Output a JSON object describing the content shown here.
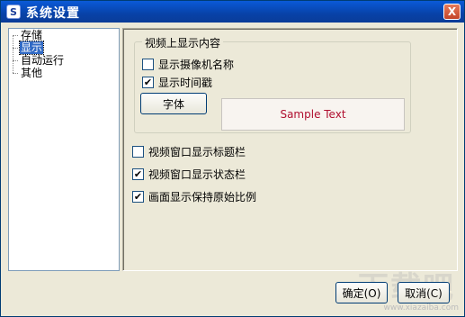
{
  "window": {
    "title": "系统设置",
    "close_label": "X"
  },
  "tree": {
    "items": [
      {
        "label": "存储",
        "selected": false
      },
      {
        "label": "显示",
        "selected": true
      },
      {
        "label": "自动运行",
        "selected": false
      },
      {
        "label": "其他",
        "selected": false
      }
    ]
  },
  "display": {
    "group_title": "视频上显示内容",
    "show_camera_name": {
      "label": "显示摄像机名称",
      "checked": false
    },
    "show_timestamp": {
      "label": "显示时间戳",
      "checked": true
    },
    "font_button": "字体",
    "sample_text": "Sample Text",
    "sample_color": "#b01030",
    "show_window_title": {
      "label": "视频窗口显示标题栏",
      "checked": false
    },
    "show_status_bar": {
      "label": "视频窗口显示状态栏",
      "checked": true
    },
    "keep_aspect": {
      "label": "画面显示保持原始比例",
      "checked": true
    }
  },
  "footer": {
    "ok_label": "确定(O)",
    "cancel_label": "取消(C)"
  },
  "watermark": {
    "big": "下载吧",
    "small": "www.xiazaiba.com"
  }
}
